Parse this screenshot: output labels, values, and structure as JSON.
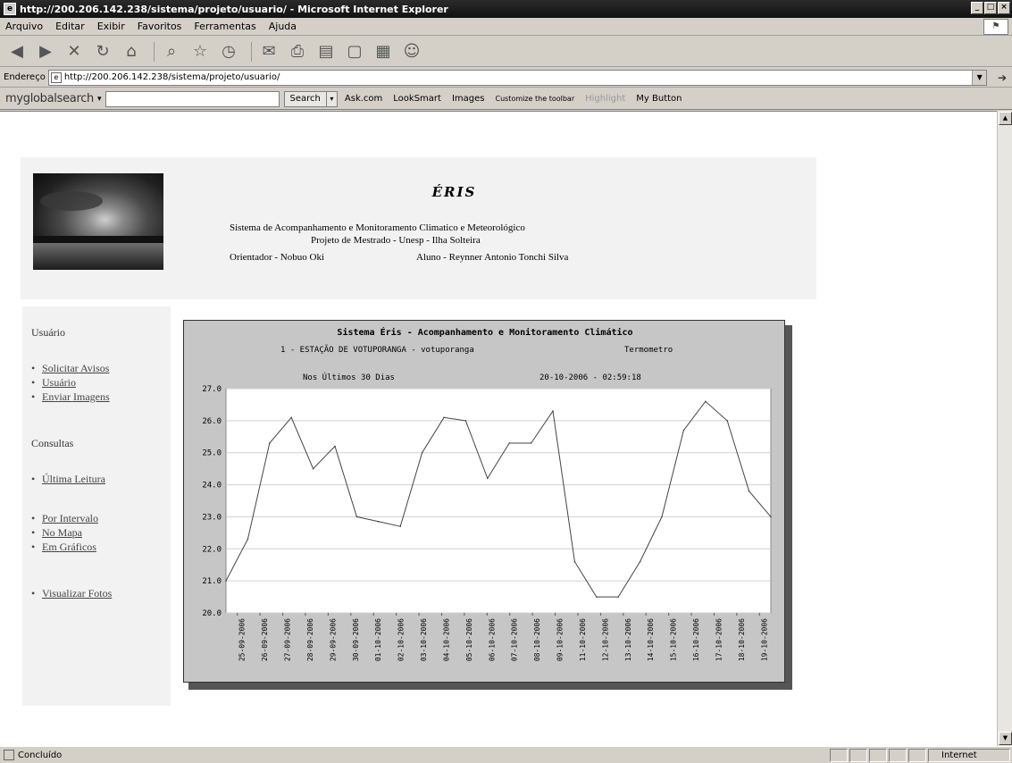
{
  "window": {
    "title": "http://200.206.142.238/sistema/projeto/usuario/ - Microsoft Internet Explorer"
  },
  "menubar": {
    "items": [
      "Arquivo",
      "Editar",
      "Exibir",
      "Favoritos",
      "Ferramentas",
      "Ajuda"
    ]
  },
  "addressbar": {
    "label": "Endereço",
    "url": "http://200.206.142.238/sistema/projeto/usuario/"
  },
  "searchbar": {
    "brand": "myglobalsearch",
    "search_label": "Search",
    "links": [
      "Ask.com",
      "LookSmart",
      "Images",
      "Customize the toolbar",
      "Highlight",
      "My Button"
    ]
  },
  "header": {
    "title": "ÉRIS",
    "line1": "Sistema de Acompanhamento e Monitoramento Climatico e Meteorológico",
    "line2": "Projeto de Mestrado - Unesp - Ilha Solteira",
    "advisor": "Orientador - Nobuo Oki",
    "student": "Aluno - Reynner Antonio Tonchi Silva"
  },
  "sidebar": {
    "heading_user": "Usuário",
    "link_request": "Solicitar Avisos",
    "link_user": "Usuário",
    "link_upload": "Enviar Imagens",
    "heading_queries": "Consultas",
    "link_last": "Última Leitura",
    "link_interval": "Por Intervalo",
    "link_map": "No Mapa",
    "link_charts": "Em Gráficos",
    "link_photos": "Visualizar Fotos"
  },
  "chart_data": {
    "type": "line",
    "title": "Sistema Éris - Acompanhamento e Monitoramento Climático",
    "subtitle_station": "1 - ESTAÇÃO DE VOTUPORANGA - votuporanga",
    "subtitle_sensor": "Termometro",
    "subtitle_period": "Nos Últimos 30 Dias",
    "subtitle_timestamp": "20-10-2006 - 02:59:18",
    "ylim": [
      20.0,
      27.0
    ],
    "yticks": [
      "27.0",
      "26.0",
      "25.0",
      "24.0",
      "23.0",
      "22.0",
      "21.0",
      "20.0"
    ],
    "grid": true,
    "categories": [
      "25-09-2006",
      "26-09-2006",
      "27-09-2006",
      "28-09-2006",
      "29-09-2006",
      "30-09-2006",
      "01-10-2006",
      "02-10-2006",
      "03-10-2006",
      "04-10-2006",
      "05-10-2006",
      "06-10-2006",
      "07-10-2006",
      "08-10-2006",
      "09-10-2006",
      "11-10-2006",
      "12-10-2006",
      "13-10-2006",
      "14-10-2006",
      "15-10-2006",
      "16-10-2006",
      "17-10-2006",
      "18-10-2006",
      "19-10-2006"
    ],
    "values": [
      21.0,
      22.3,
      25.3,
      26.1,
      24.5,
      25.2,
      23.0,
      22.85,
      22.7,
      25.0,
      26.1,
      26.0,
      24.2,
      25.3,
      25.3,
      26.3,
      21.6,
      20.5,
      20.5,
      21.6,
      23.0,
      25.7,
      26.6,
      26.0,
      23.8,
      23.0
    ],
    "line_color": "#444444",
    "plot_bg": "#ffffff",
    "panel_bg": "#c6c6c6"
  },
  "statusbar": {
    "text": "Concluído",
    "zone": "Internet"
  }
}
